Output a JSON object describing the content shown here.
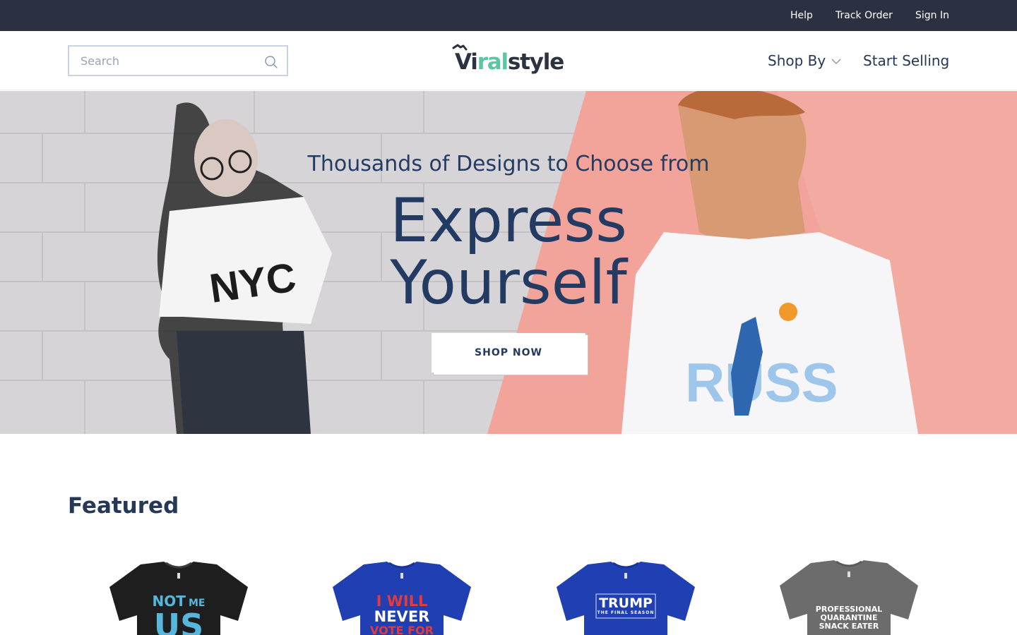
{
  "topbar": {
    "links": [
      "Help",
      "Track Order",
      "Sign In"
    ]
  },
  "header": {
    "search_placeholder": "Search",
    "logo": {
      "part1": "Vi",
      "part2": "ral",
      "part3": "style"
    },
    "nav": {
      "shop_by": "Shop By",
      "start_selling": "Start Selling"
    }
  },
  "hero": {
    "subtitle": "Thousands of Designs to Choose from",
    "title_line1": "Express",
    "title_line2": "Yourself",
    "cta": "SHOP NOW"
  },
  "featured": {
    "heading": "Featured",
    "products": [
      {
        "shirt_color": "black",
        "line1": "NOT",
        "line1b": "ME",
        "line2": "US"
      },
      {
        "shirt_color": "royal-blue",
        "line1": "I WILL",
        "line2": "NEVER",
        "line3": "VOTE FOR"
      },
      {
        "shirt_color": "royal-blue",
        "line1": "TRUMP",
        "line2": "THE FINAL SEASON"
      },
      {
        "shirt_color": "gray",
        "line1": "PROFESSIONAL",
        "line2": "QUARANTINE",
        "line3": "SNACK EATER"
      }
    ]
  },
  "colors": {
    "topbar_bg": "#2b3140",
    "brand_navy": "#233a63",
    "brand_green": "#5cc6a3",
    "hero_pink": "#f2a49a"
  },
  "icons": [
    "search-icon",
    "chevron-down-icon",
    "logo-mark-icon"
  ]
}
